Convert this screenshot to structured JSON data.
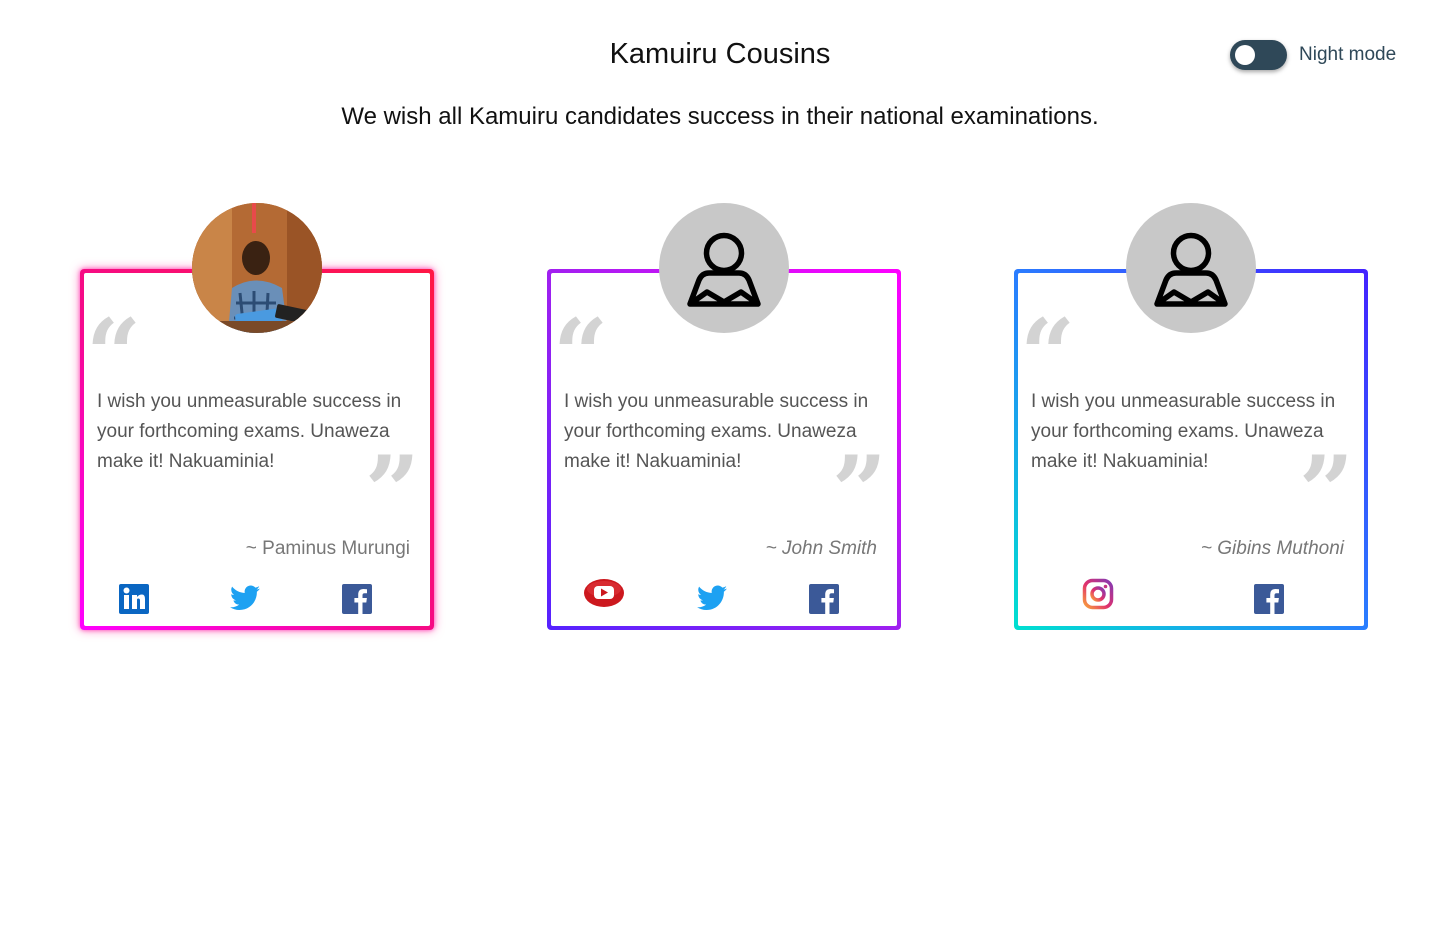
{
  "header": {
    "title": "Kamuiru Cousins",
    "night_mode_label": "Night mode",
    "night_mode_on": false
  },
  "subtitle": "We wish all Kamuiru candidates success in their national examinations.",
  "cards": [
    {
      "avatar": "profile-photo",
      "message": "I wish you unmeasurable success in your forthcoming exams. Unaweza make it! Nakuaminia!",
      "author": "~ Paminus Murungi",
      "socials": [
        "linkedin-icon",
        "twitter-icon",
        "facebook-icon"
      ]
    },
    {
      "avatar": "default-user-icon",
      "message": "I wish you unmeasurable success in your forthcoming exams. Unaweza make it! Nakuaminia!",
      "author": "~ John Smith",
      "socials": [
        "youtube-icon",
        "twitter-icon",
        "facebook-icon"
      ]
    },
    {
      "avatar": "default-user-icon",
      "message": "I wish you unmeasurable success in your forthcoming exams. Unaweza make it! Nakuaminia!",
      "author": "~ Gibins Muthoni",
      "socials": [
        "instagram-icon",
        "facebook-icon"
      ]
    }
  ],
  "colors": {
    "toggle_bg": "#2f4858",
    "quote_marks": "#d3d3d3",
    "linkedin": "#0a66c2",
    "twitter": "#1da1f2",
    "facebook": "#3b5998",
    "youtube": "#cc181e"
  }
}
